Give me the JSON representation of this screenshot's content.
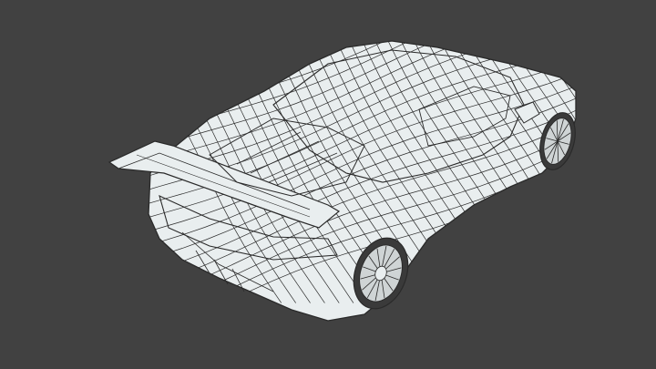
{
  "scene": {
    "background_color": "#414141",
    "surface_color": "#e9eeef",
    "wire_color": "#2a2a2a",
    "subject": "car-wireframe-render"
  }
}
